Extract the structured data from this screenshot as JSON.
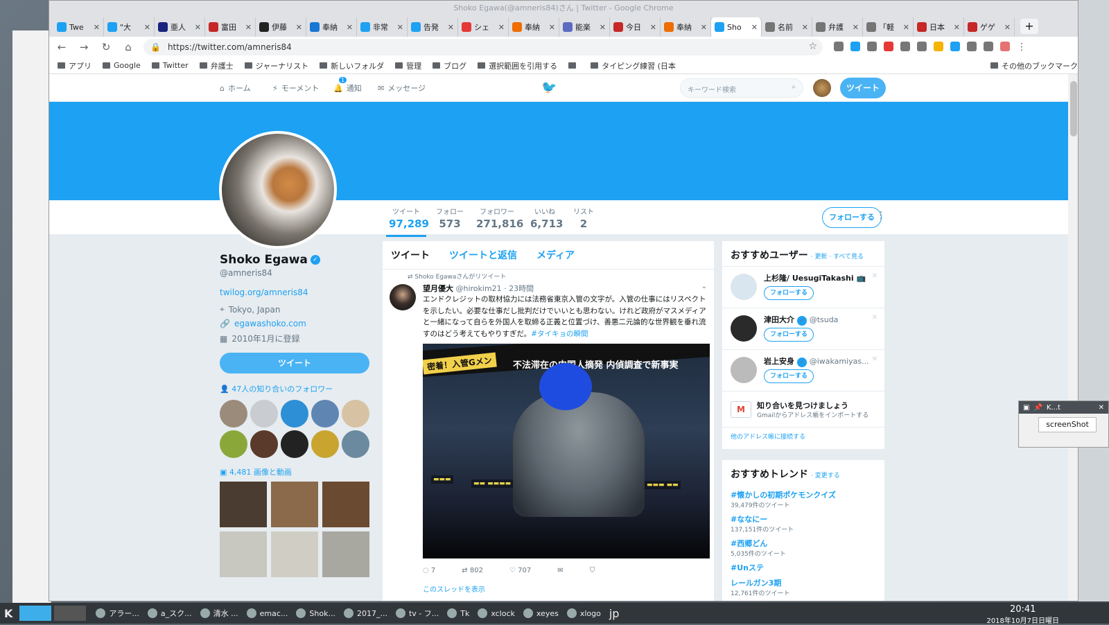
{
  "window": {
    "title": "Shoko Egawa(@amneris84)さん | Twitter - Google Chrome"
  },
  "tabs": [
    {
      "label": "Twe",
      "color": "#1da1f2",
      "icon": "twitter-icon"
    },
    {
      "label": "\"大",
      "color": "#1da1f2",
      "icon": "twitter-icon"
    },
    {
      "label": "亜人",
      "color": "#1a237e",
      "icon": "site-icon"
    },
    {
      "label": "富田",
      "color": "#c62828",
      "icon": "site-icon"
    },
    {
      "label": "伊藤",
      "color": "#222222",
      "icon": "wikipedia-icon"
    },
    {
      "label": "奉納",
      "color": "#1976d2",
      "icon": "site-icon"
    },
    {
      "label": "非常",
      "color": "#1da1f2",
      "icon": "twitter-icon"
    },
    {
      "label": "告発",
      "color": "#1da1f2",
      "icon": "twitter-icon"
    },
    {
      "label": "シェ",
      "color": "#e53935",
      "icon": "site-icon"
    },
    {
      "label": "奉納",
      "color": "#ef6c00",
      "icon": "site-icon"
    },
    {
      "label": "能楽",
      "color": "#5c6bc0",
      "icon": "site-icon"
    },
    {
      "label": "今日",
      "color": "#c62828",
      "icon": "site-icon"
    },
    {
      "label": "奉納",
      "color": "#ef6c00",
      "icon": "site-icon"
    },
    {
      "label": "Sho",
      "color": "#1da1f2",
      "icon": "twitter-icon",
      "active": true
    },
    {
      "label": "名前",
      "color": "#757575",
      "icon": "page-icon"
    },
    {
      "label": "弁護",
      "color": "#757575",
      "icon": "page-icon"
    },
    {
      "label": "「軽",
      "color": "#757575",
      "icon": "page-icon"
    },
    {
      "label": "日本",
      "color": "#c62828",
      "icon": "site-icon"
    },
    {
      "label": "ゲゲ",
      "color": "#c62828",
      "icon": "site-icon"
    }
  ],
  "toolbar": {
    "url": "https://twitter.com/amneris84"
  },
  "bookmarks": [
    "アプリ",
    "Google",
    "Twitter",
    "弁護士",
    "ジャーナリスト",
    "新しいフォルダ",
    "管理",
    "ブログ",
    "選択範囲を引用する",
    "",
    "タイピング練習 (日本",
    "その他のブックマーク"
  ],
  "twnav": {
    "home": "ホーム",
    "moments": "モーメント",
    "notif": "通知",
    "notif_count": "1",
    "messages": "メッセージ",
    "search_placeholder": "キーワード検索",
    "tweet": "ツイート"
  },
  "stats": [
    {
      "label": "ツイート",
      "value": "97,289"
    },
    {
      "label": "フォロー",
      "value": "573"
    },
    {
      "label": "フォロワー",
      "value": "271,816"
    },
    {
      "label": "いいね",
      "value": "6,713"
    },
    {
      "label": "リスト",
      "value": "2"
    }
  ],
  "profile": {
    "name": "Shoko Egawa",
    "handle": "@amneris84",
    "bio_link": "twilog.org/amneris84",
    "location": "Tokyo, Japan",
    "website": "egawashoko.com",
    "joined": "2010年1月に登録",
    "tweet_button": "ツイート",
    "follow_button": "フォローする",
    "known_followers": "47人の知り合いのフォロワー",
    "media_count": "4,481 画像と動画"
  },
  "timeline": {
    "tabs": [
      "ツイート",
      "ツイートと返信",
      "メディア"
    ],
    "retweet_note": "Shoko Egawaさんがリツイート",
    "author": "望月優大",
    "author_handle": "@hirokim21",
    "time": "· 23時間",
    "text": "エンドクレジットの取材協力には法務省東京入管の文字が。入管の仕事にはリスペクトを示したい。必要な仕事だし批判だけでいいとも思わない。けれど政府がマスメディアと一緒になって自らを外国人を取締る正義と位置づけ、善悪二元論的な世界観を垂れ流すのはどう考えてもやりすぎだ。",
    "hashtag": "#タイキョの瞬間",
    "image_badge": "密着！入管Gメン",
    "image_caption": "不法滞在の中国人摘発 内偵調査で新事実",
    "replies": "7",
    "retweets": "802",
    "likes": "707",
    "thread_link": "このスレッドを表示"
  },
  "recommended": {
    "title": "おすすめユーザー",
    "refresh": "· 更新 · すべて見る",
    "users": [
      {
        "name": "上杉隆/ UesugiTakashi",
        "handle": "",
        "follow": "フォローする"
      },
      {
        "name": "津田大介",
        "handle": "@tsuda",
        "follow": "フォローする"
      },
      {
        "name": "岩上安身",
        "handle": "@iwakamiyas...",
        "follow": "フォローする"
      }
    ],
    "find_title": "知り合いを見つけましょう",
    "find_sub": "Gmailからアドレス帳をインポートする",
    "connect": "他のアドレス帳に接続する"
  },
  "trends": {
    "title": "おすすめトレンド",
    "change": "· 変更する",
    "items": [
      {
        "tag": "#懐かしの初期ポケモンクイズ",
        "count": "39,479件のツイート"
      },
      {
        "tag": "#ななにー",
        "count": "137,151件のツイート"
      },
      {
        "tag": "#西郷どん",
        "count": "5,035件のツイート"
      },
      {
        "tag": "#Unステ",
        "count": ""
      },
      {
        "tag": "レールガン3期",
        "count": "12,761件のツイート"
      }
    ]
  },
  "ktwindow": {
    "title": "K...t",
    "button": "screenShot"
  },
  "taskbar": {
    "items": [
      "アラー...",
      "a_スク...",
      "清水 ...",
      "emac...",
      "Shok...",
      "2017_...",
      "tv - フ...",
      "Tk",
      "xclock",
      "xeyes",
      "xlogo"
    ],
    "lang": "jp",
    "time": "20:41",
    "date": "2018年10月7日日曜日"
  }
}
